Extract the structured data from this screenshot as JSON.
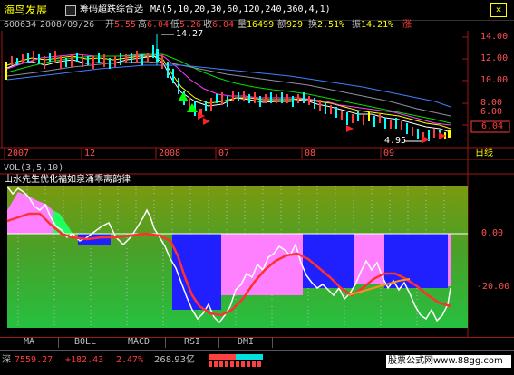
{
  "title": {
    "stock_name": "海鸟发展",
    "indicator": "筹码超跌综合选",
    "ma_params": "MA(5,10,20,30,60,120,240,360,4,1)",
    "close_button": "×"
  },
  "quote": {
    "code": "600634",
    "date": "2008/09/26",
    "open_label": "开",
    "open": "5.55",
    "high_label": "高",
    "high": "6.04",
    "low_label": "低",
    "low": "5.26",
    "close_label": "收",
    "close": "6.04",
    "vol_label": "量",
    "vol": "16499",
    "amount_label": "额",
    "amount": "929",
    "turnover_label": "换",
    "turnover": "2.51%",
    "amplitude_label": "振",
    "amplitude": "14.21%",
    "more": "涨"
  },
  "price_axis": {
    "ticks": [
      "14.00",
      "12.00",
      "10.00",
      "8.00",
      "6.00"
    ],
    "current": "6.04",
    "max_annotation": "14.27",
    "min_annotation": "4.95"
  },
  "time_axis": {
    "labels": [
      "2007",
      "12",
      "2008",
      "07",
      "08",
      "09"
    ],
    "period": "日线"
  },
  "vol_panel": {
    "label": "VOL(3,5,10)"
  },
  "osc_panel": {
    "label": "山水先生优化福如泉涌乖离韵律",
    "ticks": [
      "0.00",
      "-20.00"
    ]
  },
  "tabs": [
    "MA",
    "BOLL",
    "MACD",
    "RSI",
    "DMI"
  ],
  "status": {
    "index_name": "深",
    "index_value": "7559.27",
    "change": "+182.43",
    "change_pct": "2.47%",
    "turnover": "268.93亿",
    "watermark": "股票公式网www.88gg.com"
  },
  "colors": {
    "background": "#000000",
    "up": "#ff3c3c",
    "down": "#00ffff",
    "accent_yellow": "#ffff00",
    "axis_red": "#a01818"
  }
}
